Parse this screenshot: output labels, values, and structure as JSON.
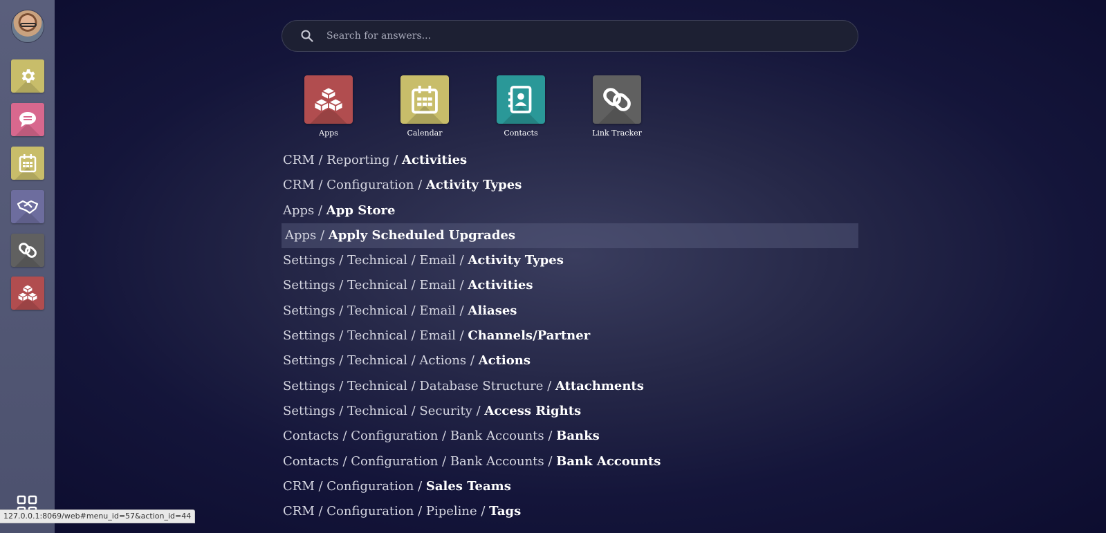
{
  "sidebar": {
    "avatar_icon": "user-avatar",
    "apps": [
      {
        "name": "settings",
        "icon": "gear-icon",
        "color": "#c8bd6a"
      },
      {
        "name": "discuss",
        "icon": "chat-bubble-icon",
        "color": "#d8688e"
      },
      {
        "name": "calendar",
        "icon": "calendar-icon",
        "color": "#c8bd6a"
      },
      {
        "name": "crm",
        "icon": "handshake-icon",
        "color": "#6d6d9e"
      },
      {
        "name": "link-tracker",
        "icon": "link-icon",
        "color": "#606060"
      },
      {
        "name": "apps",
        "icon": "cubes-icon",
        "color": "#b14d4f"
      }
    ],
    "home_toggle_icon": "grid-icon"
  },
  "search": {
    "placeholder": "Search for answers...",
    "value": ""
  },
  "app_tiles": [
    {
      "label": "Apps",
      "icon": "cubes-icon",
      "color": "#b14d4f"
    },
    {
      "label": "Calendar",
      "icon": "calendar-icon",
      "color": "#c8bd6a"
    },
    {
      "label": "Contacts",
      "icon": "address-book-icon",
      "color": "#2a9898"
    },
    {
      "label": "Link Tracker",
      "icon": "link-icon",
      "color": "#606060"
    }
  ],
  "results": [
    {
      "path": "CRM / Reporting / ",
      "last": "Activities"
    },
    {
      "path": "CRM / Configuration / ",
      "last": "Activity Types"
    },
    {
      "path": "Apps / ",
      "last": "App Store"
    },
    {
      "path": "Apps / ",
      "last": "Apply Scheduled Upgrades",
      "focused": true
    },
    {
      "path": "Settings / Technical / Email / ",
      "last": "Activity Types"
    },
    {
      "path": "Settings / Technical / Email / ",
      "last": "Activities"
    },
    {
      "path": "Settings / Technical / Email / ",
      "last": "Aliases"
    },
    {
      "path": "Settings / Technical / Email / ",
      "last": "Channels/Partner"
    },
    {
      "path": "Settings / Technical / Actions / ",
      "last": "Actions"
    },
    {
      "path": "Settings / Technical / Database Structure / ",
      "last": "Attachments"
    },
    {
      "path": "Settings / Technical / Security / ",
      "last": "Access Rights"
    },
    {
      "path": "Contacts / Configuration / Bank Accounts / ",
      "last": "Banks"
    },
    {
      "path": "Contacts / Configuration / Bank Accounts / ",
      "last": "Bank Accounts"
    },
    {
      "path": "CRM / Configuration / ",
      "last": "Sales Teams"
    },
    {
      "path": "CRM / Configuration / Pipeline / ",
      "last": "Tags"
    }
  ],
  "status_bar": {
    "url": "127.0.0.1:8069/web#menu_id=57&action_id=44"
  }
}
